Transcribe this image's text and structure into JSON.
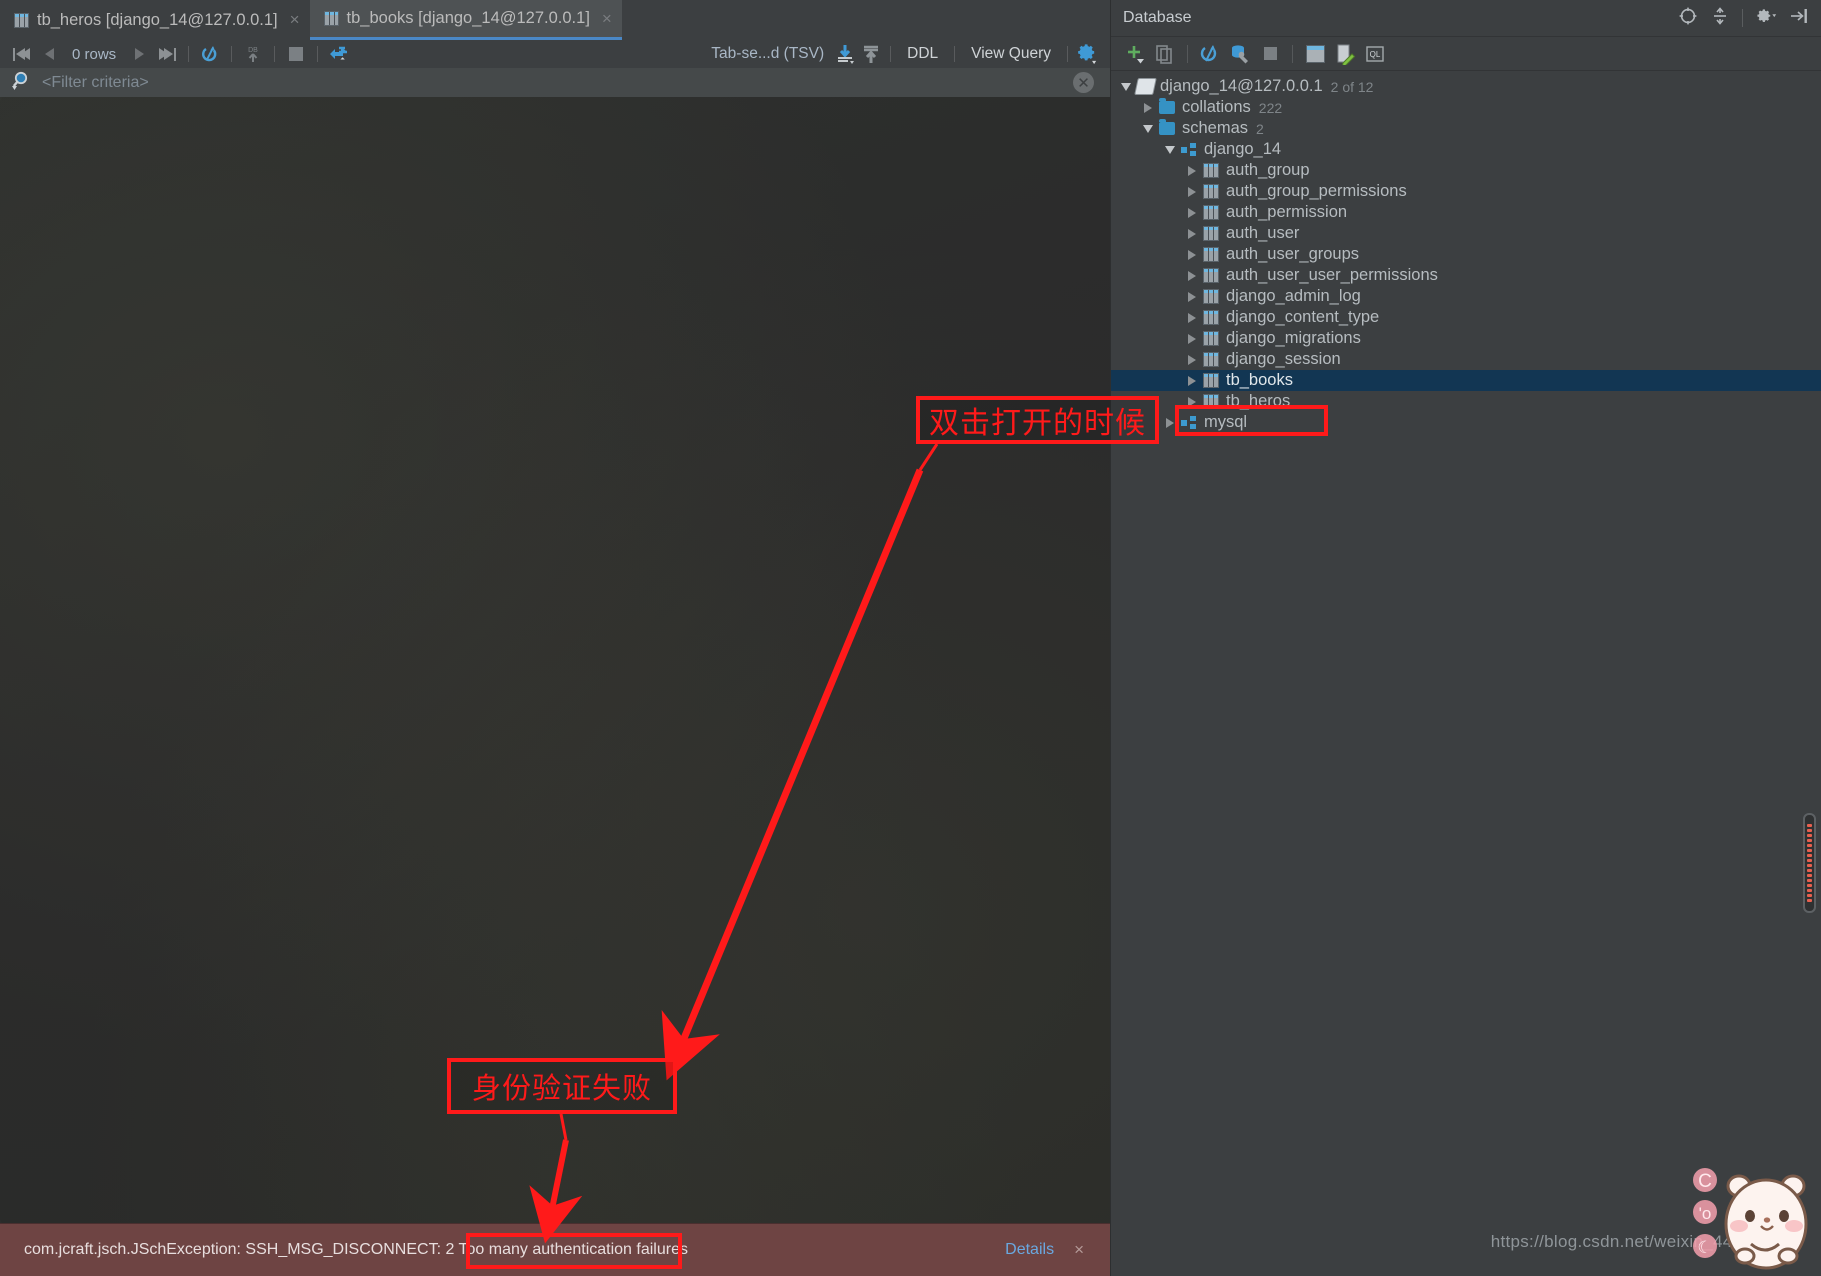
{
  "tabs": [
    {
      "label": "tb_heros [django_14@127.0.0.1]",
      "icon": "table-grid-icon",
      "active": false,
      "close": "×"
    },
    {
      "label": "tb_books [django_14@127.0.0.1]",
      "icon": "table-grid-icon",
      "active": true,
      "close": "×"
    }
  ],
  "result_toolbar": {
    "rows_label": "0 rows",
    "format_label": "Tab-se...d (TSV)",
    "ddl_label": "DDL",
    "view_query_label": "View Query",
    "icons": {
      "first_row": "first-row-icon",
      "prev_row": "previous-row-icon",
      "next_row": "next-row-icon",
      "last_row": "last-row-icon",
      "reload": "reload-page-icon",
      "db_upload": "submit-to-database-icon",
      "stop": "stop-icon",
      "transpose": "transpose-icon",
      "export_data": "export-data-icon",
      "import_data": "import-data-icon",
      "settings": "gear-icon"
    }
  },
  "filter": {
    "placeholder": "<Filter criteria>",
    "value": "",
    "search_icon": "magnifier-icon",
    "close_icon": "close-circle-icon"
  },
  "error_bar": {
    "message": "com.jcraft.jsch.JSchException: SSH_MSG_DISCONNECT: 2 Too many authentication failures",
    "details_label": "Details",
    "close_label": "×",
    "background_color": "#6e4443",
    "link_color": "#6aa8e0"
  },
  "database_panel": {
    "title": "Database",
    "header_icons": [
      "locate-icon",
      "collapse-all-icon",
      "gear-icon",
      "hide-window-icon"
    ],
    "toolbar_icons": [
      "add-new-icon",
      "duplicate-icon",
      "synchronize-icon",
      "data-source-properties-icon",
      "stop-icon",
      "open-table-editor-icon",
      "open-ddl-editor-icon",
      "open-query-console-icon"
    ],
    "tree": [
      {
        "depth": 0,
        "twist": "open",
        "icon": "data-source-icon",
        "label": "django_14@127.0.0.1",
        "count": "2 of 12",
        "selected": false
      },
      {
        "depth": 1,
        "twist": "closed",
        "icon": "folder-icon",
        "label": "collations",
        "count": "222",
        "selected": false
      },
      {
        "depth": 1,
        "twist": "open",
        "icon": "folder-icon",
        "label": "schemas",
        "count": "2",
        "selected": false
      },
      {
        "depth": 2,
        "twist": "open",
        "icon": "schema-icon",
        "label": "django_14",
        "count": "",
        "selected": false
      },
      {
        "depth": 3,
        "twist": "closed",
        "icon": "table-icon",
        "label": "auth_group",
        "count": "",
        "selected": false
      },
      {
        "depth": 3,
        "twist": "closed",
        "icon": "table-icon",
        "label": "auth_group_permissions",
        "count": "",
        "selected": false
      },
      {
        "depth": 3,
        "twist": "closed",
        "icon": "table-icon",
        "label": "auth_permission",
        "count": "",
        "selected": false
      },
      {
        "depth": 3,
        "twist": "closed",
        "icon": "table-icon",
        "label": "auth_user",
        "count": "",
        "selected": false
      },
      {
        "depth": 3,
        "twist": "closed",
        "icon": "table-icon",
        "label": "auth_user_groups",
        "count": "",
        "selected": false
      },
      {
        "depth": 3,
        "twist": "closed",
        "icon": "table-icon",
        "label": "auth_user_user_permissions",
        "count": "",
        "selected": false
      },
      {
        "depth": 3,
        "twist": "closed",
        "icon": "table-icon",
        "label": "django_admin_log",
        "count": "",
        "selected": false
      },
      {
        "depth": 3,
        "twist": "closed",
        "icon": "table-icon",
        "label": "django_content_type",
        "count": "",
        "selected": false
      },
      {
        "depth": 3,
        "twist": "closed",
        "icon": "table-icon",
        "label": "django_migrations",
        "count": "",
        "selected": false
      },
      {
        "depth": 3,
        "twist": "closed",
        "icon": "table-icon",
        "label": "django_session",
        "count": "",
        "selected": false
      },
      {
        "depth": 3,
        "twist": "closed",
        "icon": "table-icon",
        "label": "tb_books",
        "count": "",
        "selected": true
      },
      {
        "depth": 3,
        "twist": "closed",
        "icon": "table-icon",
        "label": "tb_heros",
        "count": "",
        "selected": false
      },
      {
        "depth": 2,
        "twist": "closed",
        "icon": "schema-icon",
        "label": "mysql",
        "count": "",
        "selected": false
      }
    ]
  },
  "annotations": {
    "double_click": "双击打开的时候",
    "auth_failed": "身份验证失败",
    "color": "#ff1a1a"
  },
  "watermark": {
    "url": "https://blog.csdn.net/weixin_44630560",
    "mascot": "bear-sticker-icon"
  },
  "error_stripe": {
    "name": "error-stripe-marker",
    "color": "#e8604f"
  }
}
